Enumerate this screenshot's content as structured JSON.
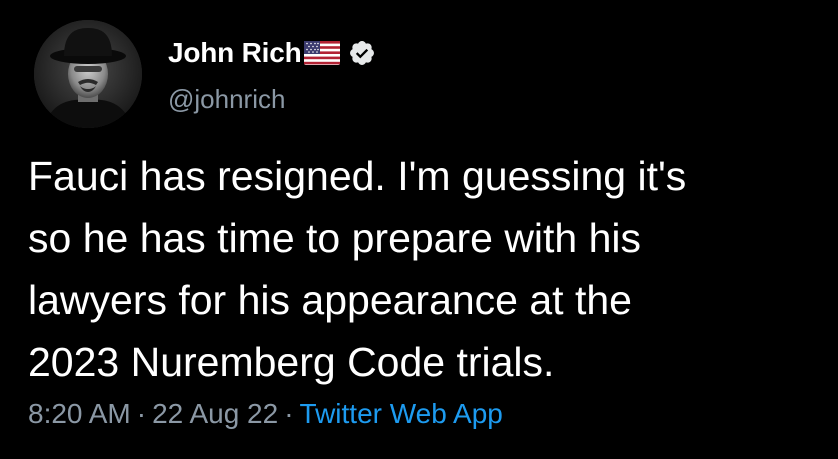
{
  "tweet": {
    "author": {
      "display_name": "John Rich",
      "handle": "@johnrich",
      "flag_icon": "us-flag-icon",
      "verified_icon": "verified-badge-icon",
      "avatar": "avatar-photo"
    },
    "text_lines": [
      "Fauci has resigned. I'm guessing it's",
      "so he has time to prepare with his",
      "lawyers for his appearance at the",
      "2023 Nuremberg Code trials."
    ],
    "time": "8:20 AM",
    "separator": "·",
    "date": "22 Aug 22",
    "source": "Twitter Web App"
  },
  "colors": {
    "background": "#000000",
    "text_primary": "#ffffff",
    "text_secondary": "#8b98a5",
    "link": "#1d9bf0"
  }
}
